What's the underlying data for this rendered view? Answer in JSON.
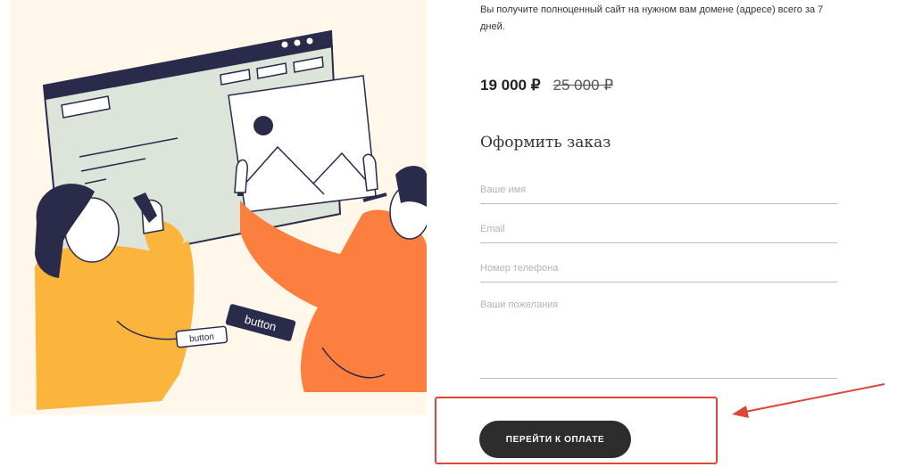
{
  "product": {
    "description": "Вы получите полноценный сайт на нужном вам домене (адресе) всего за 7 дней.",
    "price_current": "19 000 ₽",
    "price_old": "25 000 ₽"
  },
  "illustration": {
    "button_label_dark": "button",
    "button_label_light": "button"
  },
  "order_form": {
    "title": "Оформить заказ",
    "name_placeholder": "Ваше имя",
    "email_placeholder": "Email",
    "phone_placeholder": "Номер телефона",
    "wishes_placeholder": "Ваши пожелания",
    "submit_label": "ПЕРЕЙТИ К ОПЛАТЕ"
  },
  "annotation": {
    "highlight_color": "#e0453b"
  },
  "colors": {
    "illustration_bg": "#fef7ea",
    "navy": "#2a2a4a",
    "browser_panel": "#dde5da",
    "yellow_shirt": "#fbb43c",
    "orange_shirt": "#fd7f40",
    "button_dark": "#2d2d2d"
  }
}
